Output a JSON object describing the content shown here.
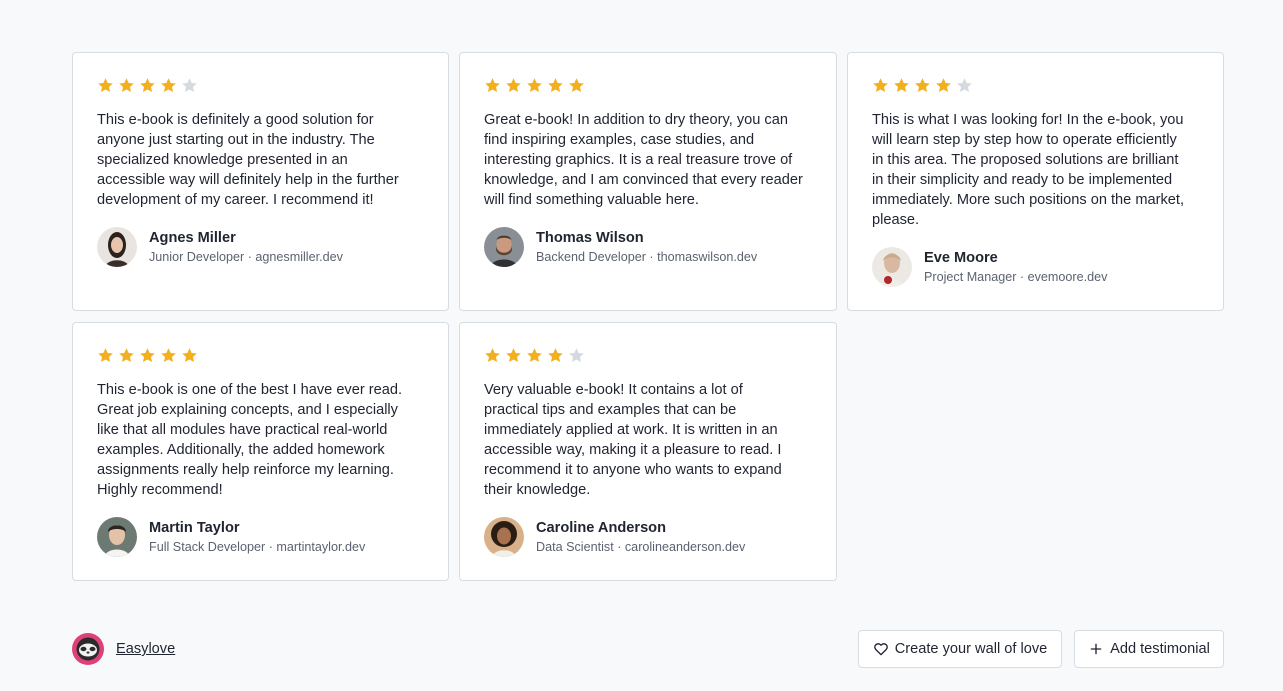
{
  "testimonials": [
    {
      "rating": 4,
      "text": "This e-book is definitely a good solution for\nanyone just starting out in the industry. The\nspecialized knowledge presented in an\naccessible way will definitely help in the further\ndevelopment of my career. I recommend it!",
      "name": "Agnes Miller",
      "role": "Junior Developer · agnesmiller.dev"
    },
    {
      "rating": 5,
      "text": "Great e-book! In addition to dry theory, you can\nfind inspiring examples, case studies, and\ninteresting graphics. It is a real treasure trove of\nknowledge, and I am convinced that every reader\nwill find something valuable here.",
      "name": "Thomas Wilson",
      "role": "Backend Developer · thomaswilson.dev"
    },
    {
      "rating": 4,
      "text": "This is what I was looking for! In the e-book, you\nwill learn step by step how to operate efficiently\nin this area. The proposed solutions are brilliant\nin their simplicity and ready to be implemented\nimmediately. More such positions on the market,\nplease.",
      "name": "Eve Moore",
      "role": "Project Manager · evemoore.dev"
    },
    {
      "rating": 5,
      "text": "This e-book is one of the best I have ever read.\nGreat job explaining concepts, and I especially\nlike that all modules have practical real-world\nexamples. Additionally, the added homework\nassignments really help reinforce my learning.\nHighly recommend!",
      "name": "Martin Taylor",
      "role": "Full Stack Developer · martintaylor.dev"
    },
    {
      "rating": 4,
      "text": "Very valuable e-book! It contains a lot of\npractical tips and examples that can be\nimmediately applied at work. It is written in an\naccessible way, making it a pleasure to read. I\nrecommend it to anyone who wants to expand\ntheir knowledge.",
      "name": "Caroline Anderson",
      "role": "Data Scientist · carolineanderson.dev"
    }
  ],
  "footer": {
    "brand_label": "Easylove",
    "brand_icon": "sloth-logo-icon",
    "create_wall_label": "Create your wall of love",
    "create_wall_icon": "heart-outline-icon",
    "add_testimonial_label": "Add testimonial",
    "add_testimonial_icon": "plus-icon"
  },
  "colors": {
    "star_filled": "#f2b01e",
    "star_empty": "#d5d9e0",
    "brand_pink": "#e0407a",
    "background": "#f8f9fb"
  }
}
